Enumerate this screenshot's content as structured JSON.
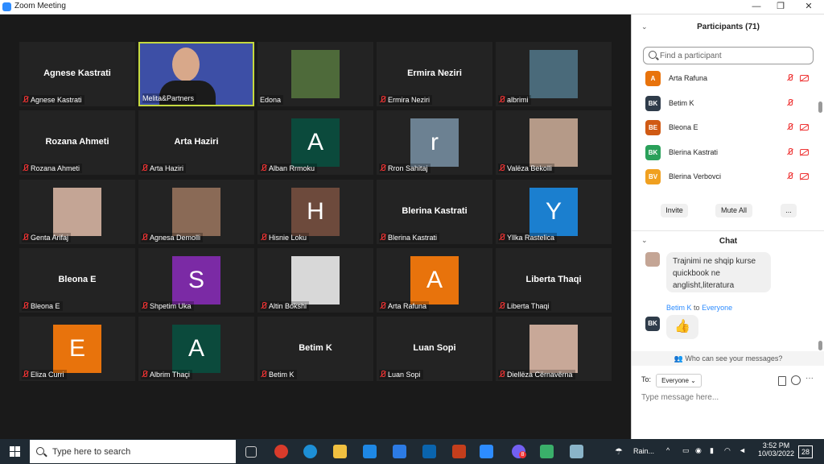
{
  "window": {
    "title": "Zoom Meeting",
    "minimize": "—",
    "restore": "❐",
    "close": "✕"
  },
  "tiles": [
    {
      "center_name": "Agnese Kastrati",
      "label": "Agnese Kastrati",
      "muted": true
    },
    {
      "type": "video",
      "label": "Melita&Partners",
      "muted": false
    },
    {
      "type": "photo",
      "label": "Edona",
      "muted": false,
      "color": "#4e6a3a"
    },
    {
      "center_name": "Ermira Neziri",
      "label": "Ermira Neziri",
      "muted": true
    },
    {
      "type": "photo",
      "label": "albrimi",
      "muted": true,
      "color": "#4a6a7a"
    },
    {
      "center_name": "Rozana Ahmeti",
      "label": "Rozana Ahmeti",
      "muted": true
    },
    {
      "center_name": "Arta Haziri",
      "label": "Arta Haziri",
      "muted": true
    },
    {
      "letter": "A",
      "label": "Alban Rrmoku",
      "muted": true,
      "color": "#0b4a3c"
    },
    {
      "letter": "r",
      "label": "Rron Sahitaj",
      "muted": true,
      "color": "#6c8192"
    },
    {
      "type": "photo",
      "label": "Valëza Bekolli",
      "muted": true,
      "color": "#b59a88"
    },
    {
      "type": "photo",
      "label": "Genta Arifaj",
      "muted": true,
      "color": "#c4a595"
    },
    {
      "type": "photo",
      "label": "Agnesa Demolli",
      "muted": true,
      "color": "#8a6a56"
    },
    {
      "letter": "H",
      "label": "Hisnie Loku",
      "muted": true,
      "color": "#6d4a3c"
    },
    {
      "center_name": "Blerina Kastrati",
      "label": "Blerina Kastrati",
      "muted": true
    },
    {
      "letter": "Y",
      "label": "Yllka Rastelica",
      "muted": true,
      "color": "#1b7fcf"
    },
    {
      "center_name": "Bleona E",
      "label": "Bleona E",
      "muted": true
    },
    {
      "letter": "S",
      "label": "Shpetim Uka",
      "muted": true,
      "color": "#7b2aa5"
    },
    {
      "type": "photo",
      "label": "Altin Bokshi",
      "muted": true,
      "color": "#d8d8d8"
    },
    {
      "letter": "A",
      "label": "Arta Rafuna",
      "muted": true,
      "color": "#e8730c"
    },
    {
      "center_name": "Liberta Thaqi",
      "label": "Liberta Thaqi",
      "muted": true
    },
    {
      "letter": "E",
      "label": "Eliza Curri",
      "muted": true,
      "color": "#e8730c"
    },
    {
      "letter": "A",
      "label": "Albrim Thaçi",
      "muted": true,
      "color": "#0b4a3c"
    },
    {
      "center_name": "Betim K",
      "label": "Betim K",
      "muted": true
    },
    {
      "center_name": "Luan Sopi",
      "label": "Luan Sopi",
      "muted": true
    },
    {
      "type": "photo",
      "label": "Diellëza Cërnavërna",
      "muted": true,
      "color": "#c8a898"
    }
  ],
  "participants": {
    "title": "Participants (71)",
    "search_placeholder": "Find a participant",
    "list": [
      {
        "initials": "A",
        "name": "Arta Rafuna",
        "color": "#e8730c"
      },
      {
        "initials": "BK",
        "name": "Betim K",
        "color": "#2f3c4a"
      },
      {
        "initials": "BE",
        "name": "Bleona E",
        "color": "#d05a14"
      },
      {
        "initials": "BK",
        "name": "Blerina Kastrati",
        "color": "#2aa05a"
      },
      {
        "initials": "BV",
        "name": "Blerina Verbovci",
        "color": "#f0a020"
      }
    ],
    "invite": "Invite",
    "mute_all": "Mute All",
    "more": "..."
  },
  "chat": {
    "title": "Chat",
    "message_text": "Trajnimi ne shqip kurse quickbook ne anglisht,literatura",
    "sender_from": "Betim K",
    "sender_to_word": "to",
    "sender_to": "Everyone",
    "sender_initials": "BK",
    "emoji": "👍",
    "who_can_see": "Who can see your messages?",
    "to_label": "To:",
    "recipient": "Everyone",
    "placeholder": "Type message here..."
  },
  "taskbar": {
    "search_placeholder": "Type here to search",
    "weather": "Rain...",
    "time": "3:52 PM",
    "date": "10/03/2022",
    "notifications": "28",
    "badge_viber": "8"
  }
}
